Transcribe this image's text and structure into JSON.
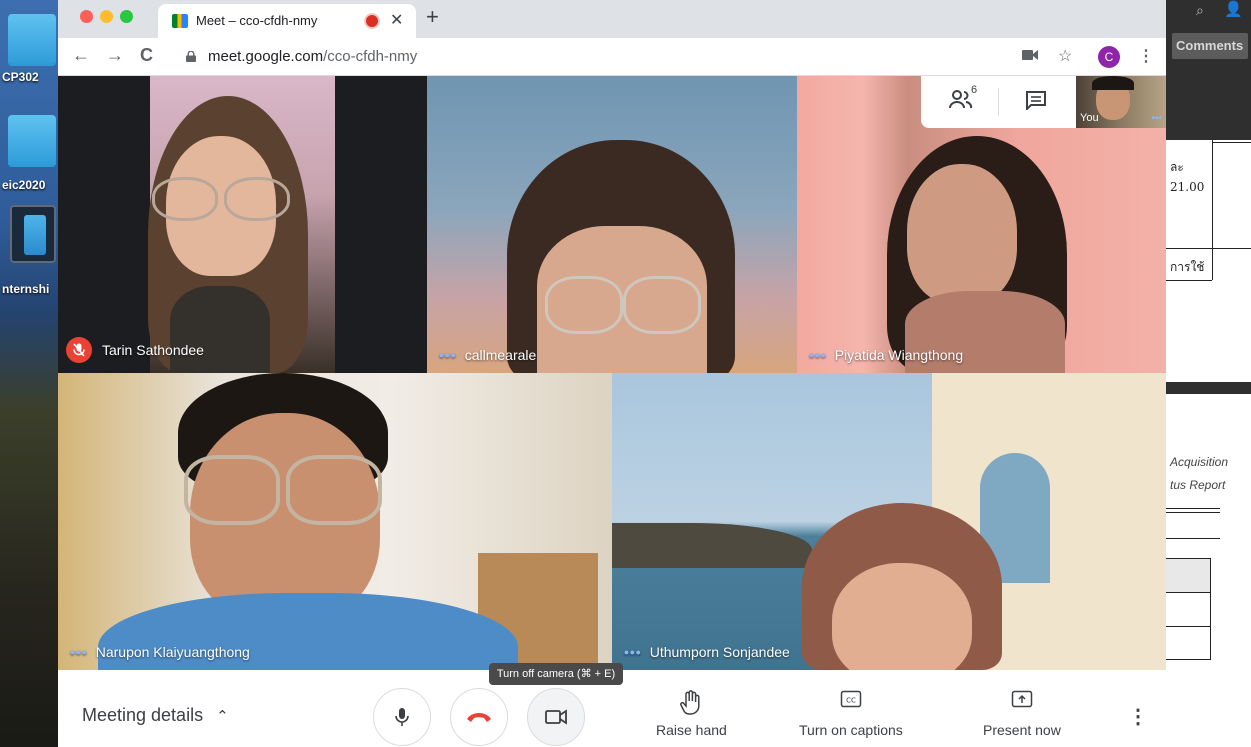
{
  "browser": {
    "tab_title": "Meet – cco-cfdh-nmy",
    "url_host": "meet.google.com",
    "url_path": "/cco-cfdh-nmy",
    "profile_initial": "C"
  },
  "desktop": {
    "labels": [
      "CP302",
      "eic2020",
      "nternshi"
    ]
  },
  "background_doc": {
    "comments_label": "Comments",
    "lines": [
      "ละ",
      "21.00",
      "การใช้",
      "Acquisition",
      "tus Report"
    ]
  },
  "meet": {
    "participant_count": "6",
    "self_label": "You",
    "participants": [
      {
        "name": "Tarin Sathondee",
        "muted": true
      },
      {
        "name": "callmearale",
        "muted": false
      },
      {
        "name": "Piyatida Wiangthong",
        "muted": false
      },
      {
        "name": "Narupon Klaiyuangthong",
        "muted": false
      },
      {
        "name": "Uthumporn Sonjandee",
        "muted": false
      }
    ],
    "controls": {
      "meeting_details": "Meeting details",
      "tooltip": "Turn off camera (⌘ + E)",
      "raise_hand": "Raise hand",
      "captions": "Turn on captions",
      "present": "Present now"
    }
  },
  "colors": {
    "hangup": "#ea4335",
    "muted": "#ea4335",
    "dots": "#8ab4f8",
    "profile": "#8e24aa"
  }
}
